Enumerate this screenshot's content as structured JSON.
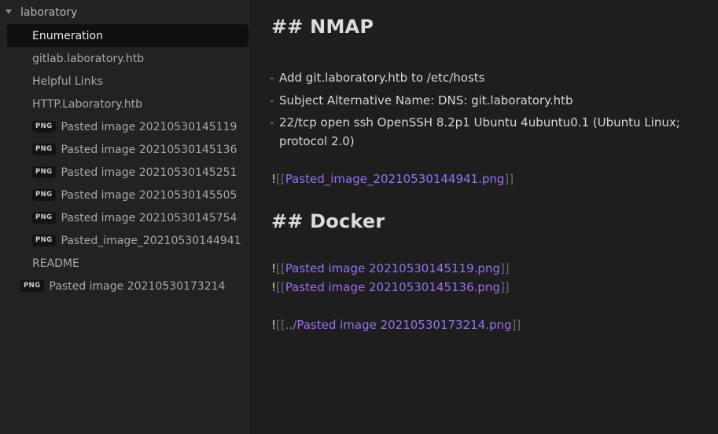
{
  "sidebar": {
    "folder": {
      "name": "laboratory",
      "icon": "chevron-down-icon",
      "items": [
        {
          "label": "Enumeration",
          "badge": "",
          "active": true
        },
        {
          "label": "gitlab.laboratory.htb",
          "badge": ""
        },
        {
          "label": "Helpful Links",
          "badge": ""
        },
        {
          "label": "HTTP.Laboratory.htb",
          "badge": ""
        },
        {
          "label": "Pasted image 20210530145119",
          "badge": "PNG"
        },
        {
          "label": "Pasted image 20210530145136",
          "badge": "PNG"
        },
        {
          "label": "Pasted image 20210530145251",
          "badge": "PNG"
        },
        {
          "label": "Pasted image 20210530145505",
          "badge": "PNG"
        },
        {
          "label": "Pasted image 20210530145754",
          "badge": "PNG"
        },
        {
          "label": "Pasted_image_20210530144941",
          "badge": "PNG"
        },
        {
          "label": "README",
          "badge": ""
        }
      ]
    },
    "root_items": [
      {
        "label": "Pasted image 20210530173214",
        "badge": "PNG"
      }
    ]
  },
  "editor": {
    "heading_nmap": "## NMAP",
    "bullets": [
      {
        "dash": "-",
        "text": "Add git.laboratory.htb to /etc/hosts"
      },
      {
        "dash": "-",
        "text": "Subject Alternative Name: DNS: git.laboratory.htb"
      },
      {
        "dash": "-",
        "text": "22/tcp open ssh OpenSSH 8.2p1 Ubuntu 4ubuntu0.1 (Ubuntu Linux; protocol 2.0)"
      }
    ],
    "embed_nmap": {
      "bang": "!",
      "open": "[[",
      "link": "Pasted_image_20210530144941.png",
      "close": "]]"
    },
    "heading_docker": "## Docker",
    "embeds_docker": [
      {
        "bang": "!",
        "open": "[[",
        "link": "Pasted image 20210530145119.png",
        "close": "]]"
      },
      {
        "bang": "!",
        "open": "[[",
        "link": "Pasted image 20210530145136.png",
        "close": "]]"
      },
      {
        "bang": "!",
        "open": "[[",
        "link": "../Pasted image 20210530173214.png",
        "close": "]]"
      }
    ]
  },
  "colors": {
    "background": "#1e1e1e",
    "sidebar": "#222222",
    "active_item": "#0f0f0f",
    "link": "#9b6ff0",
    "bracket": "#6c6c6c"
  }
}
